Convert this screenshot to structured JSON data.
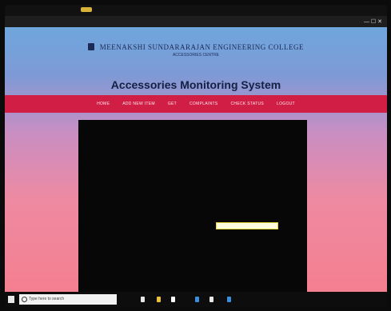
{
  "header": {
    "college_name": "MEENAKSHI SUNDARARAJAN ENGINEERING COLLEGE",
    "college_subtitle": "ACCESSORIES CENTRE",
    "system_title": "Accessories Monitoring System"
  },
  "nav": {
    "items": [
      "Home",
      "Add new item",
      "Get",
      "Complaints",
      "Check status",
      "Logout"
    ]
  },
  "taskbar": {
    "search_placeholder": "Type here to search"
  },
  "colors": {
    "nav_bar": "#d01e45",
    "panel": "#070707",
    "title_text": "#142044"
  }
}
